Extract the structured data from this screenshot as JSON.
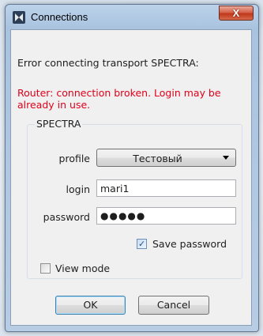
{
  "window": {
    "title": "Connections",
    "close_label": "X"
  },
  "message": {
    "main": "Error connecting transport SPECTRA:",
    "error_line1": "Router: connection broken. Login may be",
    "error_line2": "already in use."
  },
  "group": {
    "title": "SPECTRA"
  },
  "form": {
    "profile_label": "profile",
    "profile_value": "Тестовый",
    "login_label": "login",
    "login_value": "mari1",
    "password_label": "password",
    "password_mask": "●●●●●"
  },
  "options": {
    "save_password_label": "Save password",
    "save_password_checked": true,
    "view_mode_label": "View mode",
    "view_mode_checked": false
  },
  "buttons": {
    "ok": "OK",
    "cancel": "Cancel"
  },
  "colors": {
    "error": "#e0001a",
    "default_button_border": "#3c7fb1"
  }
}
